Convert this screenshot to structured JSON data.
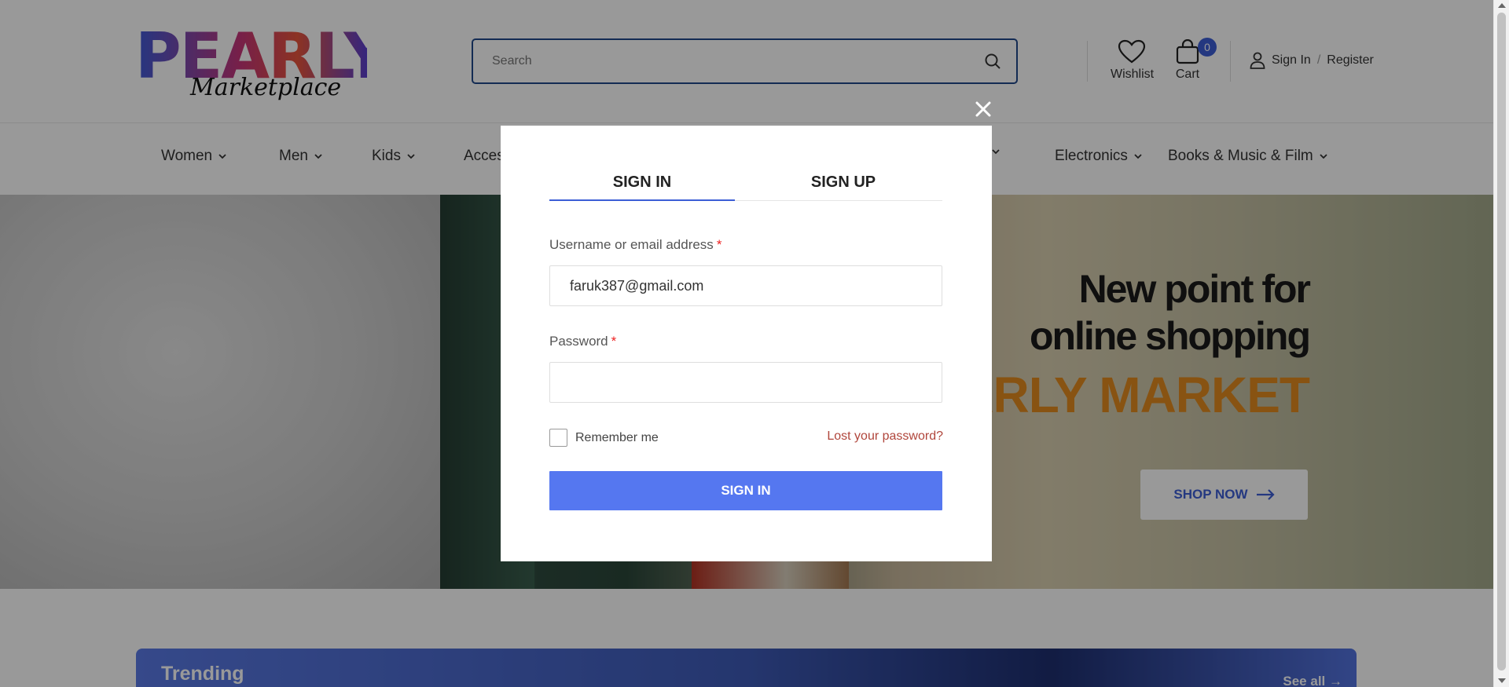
{
  "brand": {
    "logo_word": "PEARLY",
    "logo_sub": "Marketplace"
  },
  "header": {
    "search_placeholder": "Search",
    "wishlist_label": "Wishlist",
    "cart_label": "Cart",
    "cart_count": "0",
    "signin_label": "Sign In",
    "separator": "/",
    "register_label": "Register"
  },
  "nav": {
    "items": [
      {
        "label": "Women"
      },
      {
        "label": "Men"
      },
      {
        "label": "Kids"
      },
      {
        "label": "Acces"
      },
      {
        "label": "Electronics"
      },
      {
        "label": "Books & Music & Film"
      }
    ]
  },
  "hero": {
    "title_line1": "New point for",
    "title_line2": "online shopping",
    "brand_text": "ARLY MARKET",
    "shop_button": "SHOP NOW"
  },
  "trending": {
    "title": "Trending",
    "see_all": "See all →"
  },
  "modal": {
    "tab_signin": "SIGN IN",
    "tab_signup": "SIGN UP",
    "username_label": "Username or email address",
    "username_value": "faruk387@gmail.com",
    "required_mark": "*",
    "password_label": "Password",
    "password_value": "",
    "remember_label": "Remember me",
    "lost_password": "Lost your password?",
    "submit_label": "SIGN IN"
  },
  "colors": {
    "accent": "#3c5ed6",
    "button": "#5577f0",
    "hero_brand": "#e38b1e",
    "lost_link": "#b0453b"
  }
}
